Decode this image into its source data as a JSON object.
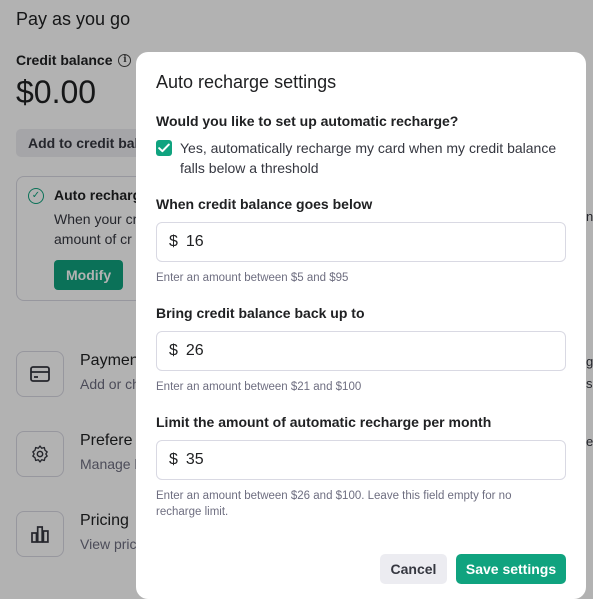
{
  "background": {
    "page_title": "Pay as you go",
    "credit_balance_label": "Credit balance",
    "credit_balance_value": "$0.00",
    "add_credit_button": "Add to credit bala",
    "auto_recharge": {
      "title": "Auto recharg",
      "description": "When your cr⁠ amount of cr",
      "desc_line1": "When your cr",
      "desc_line2": "amount of cr",
      "modify_button": "Modify"
    },
    "right_edge_texts": [
      "n",
      "g",
      "sa",
      "e"
    ],
    "items": [
      {
        "title": "Paymen",
        "subtitle": "Add or ch",
        "icon": "credit-card-icon"
      },
      {
        "title": "Prefere",
        "subtitle": "Manage b",
        "icon": "gear-icon"
      },
      {
        "title": "Pricing",
        "subtitle": "View pric",
        "icon": "bar-chart-icon"
      }
    ]
  },
  "modal": {
    "title": "Auto recharge settings",
    "question": "Would you like to set up automatic recharge?",
    "checkbox_checked": true,
    "checkbox_label": "Yes, automatically recharge my card when my credit balance falls below a threshold",
    "fields": [
      {
        "label": "When credit balance goes below",
        "currency": "$",
        "value": "16",
        "help": "Enter an amount between $5 and $95"
      },
      {
        "label": "Bring credit balance back up to",
        "currency": "$",
        "value": "26",
        "help": "Enter an amount between $21 and $100"
      },
      {
        "label": "Limit the amount of automatic recharge per month",
        "currency": "$",
        "value": "35",
        "help": "Enter an amount between $26 and $100. Leave this field empty for no recharge limit."
      }
    ],
    "cancel_button": "Cancel",
    "save_button": "Save settings"
  },
  "colors": {
    "accent": "#10a37f",
    "overlay": "rgba(0,0,0,0.30)"
  }
}
